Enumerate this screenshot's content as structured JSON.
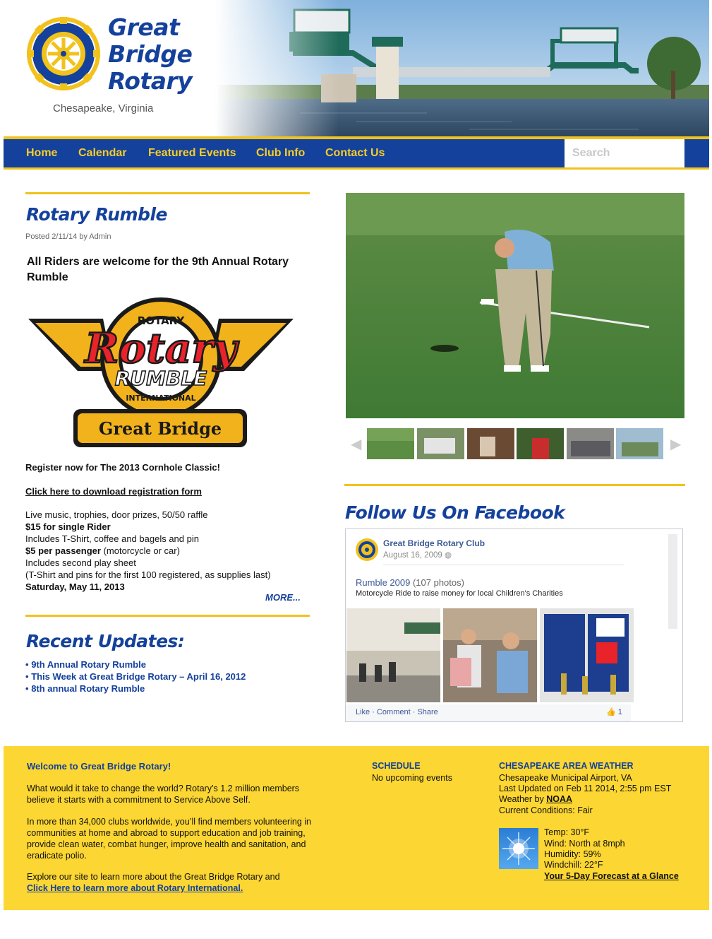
{
  "site": {
    "brand_lines": [
      "Great",
      "Bridge",
      "Rotary"
    ],
    "tagline": "Chesapeake, Virginia",
    "logo_text": "ROTARY INTERNATIONAL"
  },
  "nav": {
    "items": [
      "Home",
      "Calendar",
      "Featured Events",
      "Club Info",
      "Contact Us"
    ],
    "search_placeholder": "Search"
  },
  "post": {
    "title": "Rotary Rumble",
    "posted": "Posted 2/11/14 by Admin",
    "intro": "All Riders are welcome for the 9th Annual Rotary Rumble",
    "logo": {
      "ring": "ROTARY",
      "word": "Rotary",
      "sub": "RUMBLE",
      "ring_bottom": "INTERNATIONAL",
      "banner": "Great Bridge"
    },
    "register": "Register now for The 2013 Cornhole Classic!",
    "download_link": "Click here to download registration form",
    "details": [
      {
        "text": "Live music, trophies, door prizes, 50/50 raffle",
        "bold": false
      },
      {
        "text": "$15 for single Rider",
        "bold": true
      },
      {
        "text": "Includes T-Shirt, coffee and bagels and pin",
        "bold": false
      },
      {
        "text": "$5 per passenger",
        "bold": true,
        "suffix": " (motorcycle or car)"
      },
      {
        "text": "Includes second play sheet",
        "bold": false
      },
      {
        "text": "(T-Shirt and pins for the first 100 registered, as supplies last)",
        "bold": false
      },
      {
        "text": "Saturday, May 11, 2013",
        "bold": true
      }
    ],
    "more": "MORE..."
  },
  "recent": {
    "title": "Recent Updates:",
    "items": [
      "9th Annual Rotary Rumble",
      "This Week at Great Bridge Rotary – April 16, 2012",
      "8th annual Rotary Rumble"
    ],
    "bullet": "•"
  },
  "gallery": {
    "thumb_count": 6
  },
  "facebook": {
    "title": "Follow Us On Facebook",
    "page_name": "Great Bridge Rotary Club",
    "date": "August 16, 2009",
    "album": "Rumble 2009",
    "album_count": "(107 photos)",
    "description": "Motorcycle Ride to raise money for local Children's Charities",
    "actions": [
      "Like",
      "Comment",
      "Share"
    ],
    "action_sep": " · ",
    "likes": "1"
  },
  "footer": {
    "welcome_title": "Welcome to Great Bridge Rotary!",
    "p1": "What would it take to change the world? Rotary’s 1.2 million members believe it starts with a commitment to Service Above Self.",
    "p2": "In more than 34,000 clubs worldwide, you’ll find members volunteering in communities at home and abroad to support education and job training, provide clean water, combat hunger, improve health and sanitation, and eradicate polio.",
    "p3": "Explore our site to learn more about the Great Bridge Rotary and",
    "p3_link": "Click Here to learn more about Rotary International.",
    "schedule_title": "SCHEDULE",
    "schedule_text": "No upcoming events",
    "weather_title": "CHESAPEAKE AREA WEATHER",
    "weather_location": "Chesapeake Municipal Airport, VA",
    "weather_updated": "Last Updated on Feb 11 2014, 2:55 pm EST",
    "weather_by": "Weather by",
    "weather_by_link": "NOAA",
    "conditions_label": "Current Conditions:",
    "conditions_value": "Fair",
    "temp": "Temp: 30°F",
    "wind": "Wind: North at 8mph",
    "humidity": "Humidity: 59%",
    "windchill": "Windchill: 22°F",
    "forecast_link": "Your 5-Day Forecast at a Glance"
  },
  "colors": {
    "rotary_blue": "#14419b",
    "rotary_gold": "#f2c21c",
    "footer_yellow": "#fcd632",
    "facebook_blue": "#3b5998"
  }
}
